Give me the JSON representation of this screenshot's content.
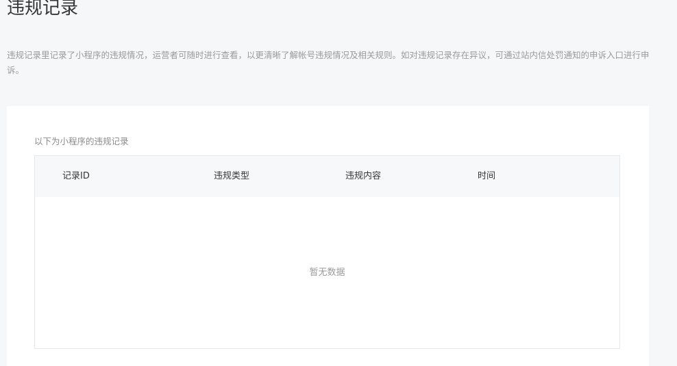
{
  "page": {
    "title": "违规记录",
    "description": "违规记录里记录了小程序的违规情况，运营者可随时进行查看，以更清晰了解帐号违规情况及相关规则。如对违规记录存在异议，可通过站内信处罚通知的申诉入口进行申诉。"
  },
  "records": {
    "subtitle": "以下为小程序的违规记录",
    "columns": [
      "记录ID",
      "违规类型",
      "违规内容",
      "时间"
    ],
    "rows": [],
    "empty_text": "暂无数据"
  }
}
